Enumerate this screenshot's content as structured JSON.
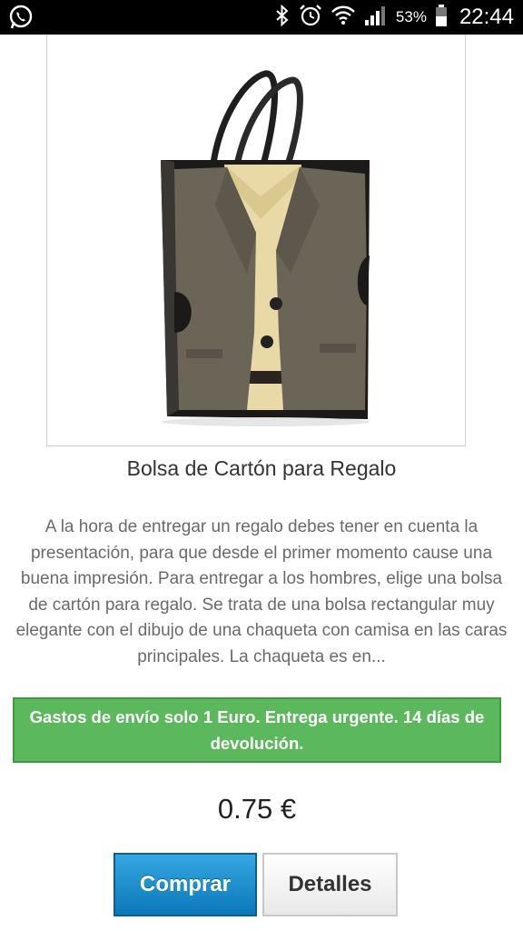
{
  "status_bar": {
    "battery_percent": "53%",
    "time": "22:44",
    "icons": [
      "whatsapp-icon",
      "bluetooth-icon",
      "alarm-icon",
      "wifi-icon",
      "signal-icon",
      "battery-icon"
    ]
  },
  "product": {
    "image_alt": "product-photo-gift-bag",
    "title": "Bolsa de Cartón para Regalo",
    "description": "A la hora de entregar un regalo debes tener en cuenta la presentación, para que desde el primer momento cause una buena impresión. Para entregar a los hombres, elige una bolsa de cartón para regalo. Se trata de una bolsa rectangular muy elegante con el dibujo de una chaqueta con camisa en las caras principales. La chaqueta es en...",
    "shipping_notice": "Gastos de envío solo 1 Euro. Entrega urgente. 14 días de devolución.",
    "price": "0.75 €"
  },
  "actions": {
    "buy_label": "Comprar",
    "details_label": "Detalles"
  },
  "colors": {
    "banner_green": "#5cb85c",
    "buy_blue": "#1a8fd0"
  }
}
